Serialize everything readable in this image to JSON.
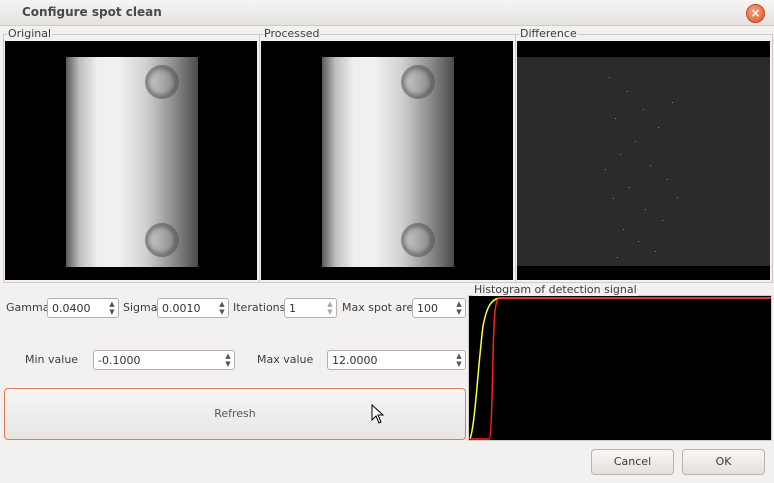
{
  "window": {
    "title": "Configure spot clean",
    "close_glyph": "×"
  },
  "panels": {
    "original_label": "Original",
    "processed_label": "Processed",
    "difference_label": "Difference"
  },
  "params": {
    "gamma_label": "Gamma",
    "gamma_value": "0.0400",
    "sigma_label": "Sigma",
    "sigma_value": "0.0010",
    "iterations_label": "Iterations",
    "iterations_value": "1",
    "max_spot_area_label": "Max spot area",
    "max_spot_area_value": "100",
    "min_value_label": "Min value",
    "min_value_value": "-0.1000",
    "max_value_label": "Max value",
    "max_value_value": "12.0000"
  },
  "refresh_label": "Refresh",
  "histogram": {
    "title": "Histogram of detection signal",
    "curve_colors": [
      "#ffff33",
      "#ff2020"
    ]
  },
  "buttons": {
    "cancel": "Cancel",
    "ok": "OK"
  },
  "spin_arrows": {
    "up": "▲",
    "down": "▼"
  },
  "colors": {
    "accent": "#e27a55",
    "close": "#e0562a",
    "image_bg": "#000000"
  },
  "icons": {
    "close": "close-icon",
    "cursor": "mouse-pointer-icon"
  }
}
